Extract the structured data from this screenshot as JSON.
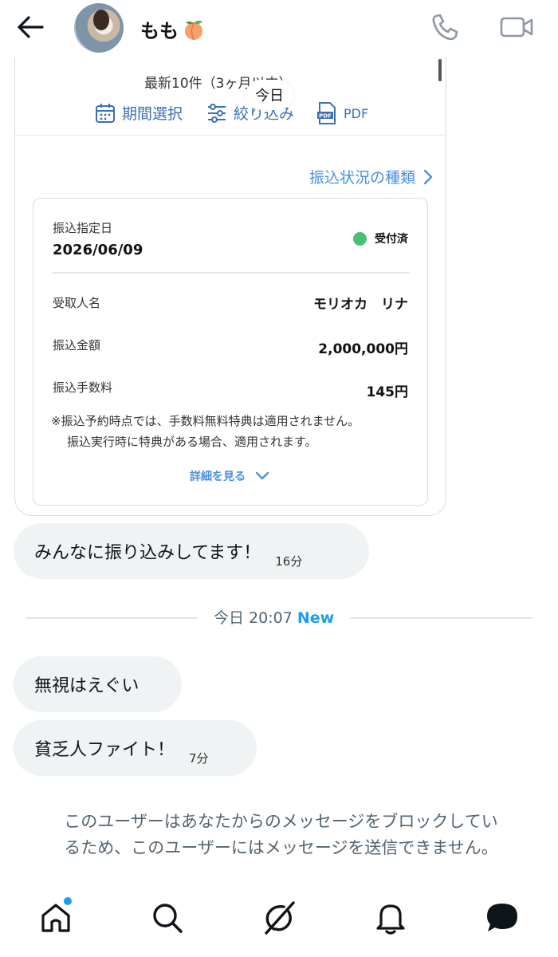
{
  "header": {
    "back_icon": "arrow-left-icon",
    "name": "もも",
    "name_emoji_icon": "peach-emoji-icon",
    "call_icon": "phone-icon",
    "video_icon": "video-camera-icon"
  },
  "card": {
    "recent_label": "最新10件（3ヶ月以内）",
    "today_chip": "今日",
    "tools": [
      {
        "label": "期間選択",
        "icon": "calendar-icon"
      },
      {
        "label": "絞り込み",
        "icon": "filter-sliders-icon"
      },
      {
        "label": "PDF",
        "icon": "pdf-file-icon"
      }
    ],
    "kinds_link": "振込状況の種類",
    "transfer": {
      "date_label": "振込指定日",
      "date_value": "2026/06/09",
      "status": "受付済",
      "status_color": "#4bbf78",
      "recipient_label": "受取人名",
      "recipient_value": "モリオカ　リナ",
      "amount_label": "振込金額",
      "amount_value": "2,000,000円",
      "fee_label": "振込手数料",
      "fee_value": "145円",
      "note_line1": "※振込予約時点では、手数料無料特典は適用されません。",
      "note_line2": "振込実行時に特典がある場合、適用されます。",
      "detail_link": "詳細を見る"
    }
  },
  "messages": [
    {
      "text": "みんなに振り込みしてます！",
      "time": "16分"
    },
    {
      "text": "無視はえぐい",
      "time": ""
    },
    {
      "text": "貧乏人ファイト！",
      "time": "7分"
    }
  ],
  "divider": {
    "time": "今日 20:07",
    "new": "New"
  },
  "blocked_notice": {
    "line1": "このユーザーはあなたからのメッセージをブロックしてい",
    "line2": "るため、このユーザーにはメッセージを送信できません。"
  },
  "nav": {
    "items": [
      "home-icon",
      "search-icon",
      "grok-icon",
      "bell-icon",
      "messages-icon"
    ]
  },
  "colors": {
    "accent": "#1d9bf0",
    "link_blue": "#4a90e2",
    "bubble_bg": "#eff3f4"
  }
}
